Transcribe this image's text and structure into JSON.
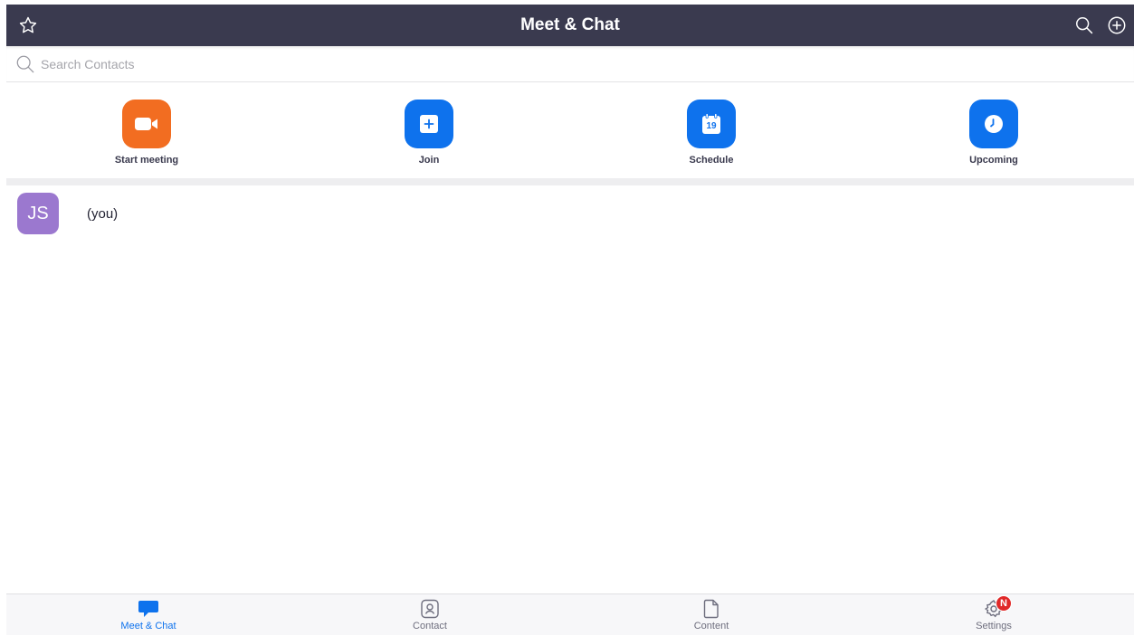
{
  "header": {
    "title": "Meet & Chat",
    "left_icon": "star-icon",
    "right_icons": [
      "search-icon",
      "add-circle-icon"
    ]
  },
  "search": {
    "placeholder": "Search Contacts",
    "value": ""
  },
  "actions": [
    {
      "label": "Start meeting",
      "icon": "video-camera-icon",
      "color": "#f26d21"
    },
    {
      "label": "Join",
      "icon": "plus-square-icon",
      "color": "#0e72ed"
    },
    {
      "label": "Schedule",
      "icon": "calendar-icon",
      "color": "#0e72ed",
      "icon_text": "19"
    },
    {
      "label": "Upcoming",
      "icon": "clock-icon",
      "color": "#0e72ed"
    }
  ],
  "contacts": [
    {
      "initials": "JS",
      "name": "(you)",
      "avatar_color": "#9b78cf"
    }
  ],
  "bottom_nav": {
    "active": "Meet & Chat",
    "items": [
      {
        "label": "Meet & Chat",
        "icon": "chat-bubble-icon"
      },
      {
        "label": "Contact",
        "icon": "contact-card-icon"
      },
      {
        "label": "Content",
        "icon": "document-icon"
      },
      {
        "label": "Settings",
        "icon": "gear-icon",
        "badge": "N"
      }
    ]
  },
  "colors": {
    "header_bg": "#3a3a4f",
    "accent": "#0e72ed",
    "orange": "#f26d21",
    "badge": "#e02828"
  }
}
